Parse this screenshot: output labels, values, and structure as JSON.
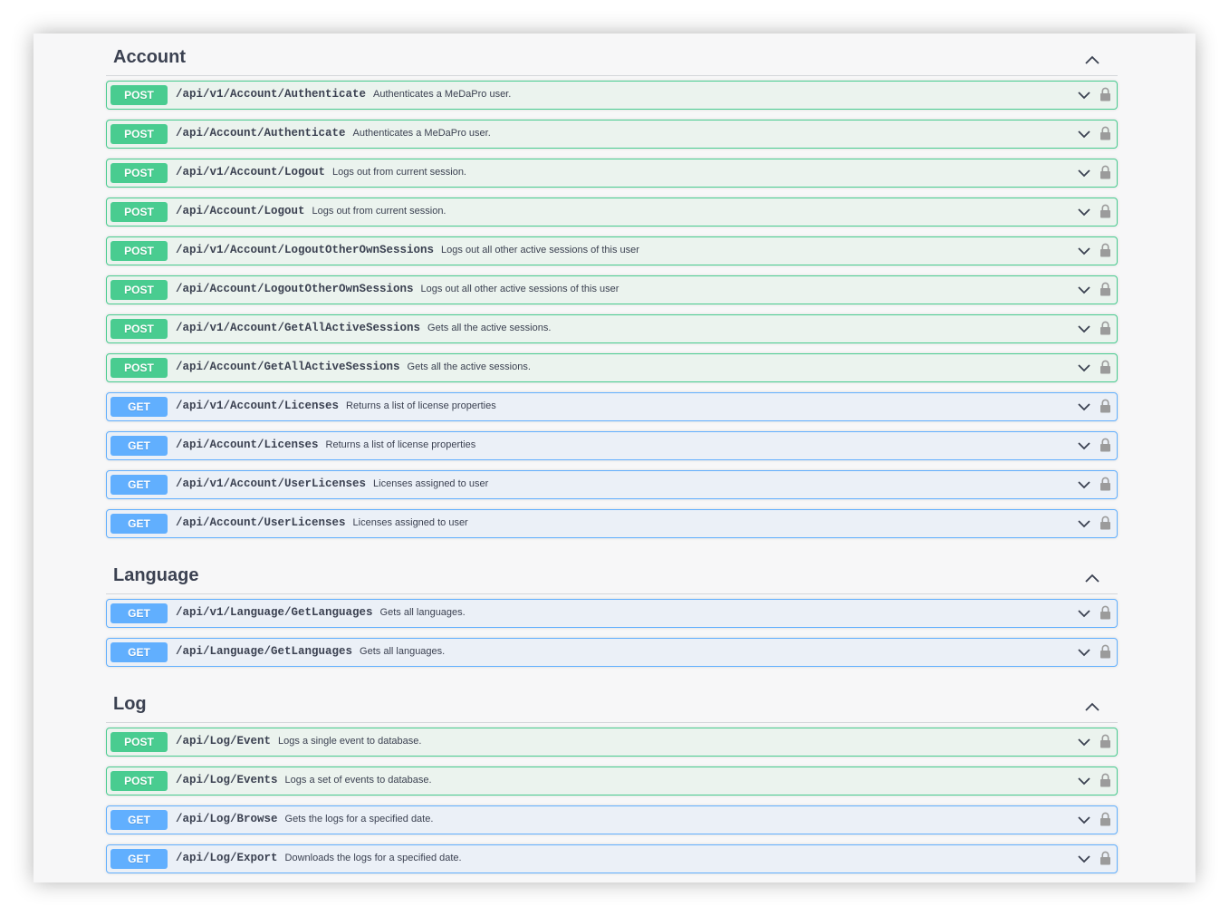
{
  "sections": [
    {
      "title": "Account",
      "operations": [
        {
          "method": "POST",
          "path": "/api/v1/Account/Authenticate",
          "desc": "Authenticates a MeDaPro user."
        },
        {
          "method": "POST",
          "path": "/api/Account/Authenticate",
          "desc": "Authenticates a MeDaPro user."
        },
        {
          "method": "POST",
          "path": "/api/v1/Account/Logout",
          "desc": "Logs out from current session."
        },
        {
          "method": "POST",
          "path": "/api/Account/Logout",
          "desc": "Logs out from current session."
        },
        {
          "method": "POST",
          "path": "/api/v1/Account/LogoutOtherOwnSessions",
          "desc": "Logs out all other active sessions of this user"
        },
        {
          "method": "POST",
          "path": "/api/Account/LogoutOtherOwnSessions",
          "desc": "Logs out all other active sessions of this user"
        },
        {
          "method": "POST",
          "path": "/api/v1/Account/GetAllActiveSessions",
          "desc": "Gets all the active sessions."
        },
        {
          "method": "POST",
          "path": "/api/Account/GetAllActiveSessions",
          "desc": "Gets all the active sessions."
        },
        {
          "method": "GET",
          "path": "/api/v1/Account/Licenses",
          "desc": "Returns a list of license properties"
        },
        {
          "method": "GET",
          "path": "/api/Account/Licenses",
          "desc": "Returns a list of license properties"
        },
        {
          "method": "GET",
          "path": "/api/v1/Account/UserLicenses",
          "desc": "Licenses assigned to user"
        },
        {
          "method": "GET",
          "path": "/api/Account/UserLicenses",
          "desc": "Licenses assigned to user"
        }
      ]
    },
    {
      "title": "Language",
      "operations": [
        {
          "method": "GET",
          "path": "/api/v1/Language/GetLanguages",
          "desc": "Gets all languages."
        },
        {
          "method": "GET",
          "path": "/api/Language/GetLanguages",
          "desc": "Gets all languages."
        }
      ]
    },
    {
      "title": "Log",
      "operations": [
        {
          "method": "POST",
          "path": "/api/Log/Event",
          "desc": "Logs a single event to database."
        },
        {
          "method": "POST",
          "path": "/api/Log/Events",
          "desc": "Logs a set of events to database."
        },
        {
          "method": "GET",
          "path": "/api/Log/Browse",
          "desc": "Gets the logs for a specified date."
        },
        {
          "method": "GET",
          "path": "/api/Log/Export",
          "desc": "Downloads the logs for a specified date."
        }
      ]
    }
  ],
  "icons": {
    "section_toggle": "chevron-up-icon",
    "operation_toggle": "chevron-down-icon",
    "auth": "lock-icon"
  },
  "colors": {
    "post": "#49cc90",
    "get": "#61affe",
    "text": "#3b4151"
  }
}
